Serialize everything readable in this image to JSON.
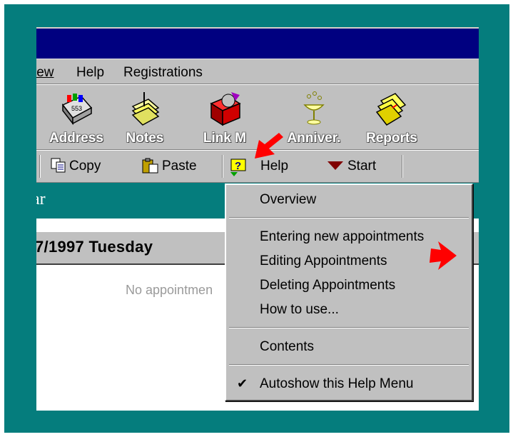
{
  "menubar": {
    "items": [
      {
        "label": "iew",
        "underline_index": 0
      },
      {
        "label": "Help",
        "underline_index": 0
      },
      {
        "label": "Registrations",
        "underline_index": 0
      }
    ]
  },
  "toolbar_large": {
    "buttons": [
      {
        "label": "Address",
        "icon": "address-book-icon"
      },
      {
        "label": "Notes",
        "icon": "notes-icon"
      },
      {
        "label": "Link M",
        "icon": "link-manager-icon"
      },
      {
        "label": "Anniver.",
        "icon": "anniversary-icon"
      },
      {
        "label": "Reports",
        "icon": "reports-icon"
      }
    ]
  },
  "toolbar_small": {
    "copy_label": "Copy",
    "paste_label": "Paste",
    "help_label": "Help",
    "start_label": "Start"
  },
  "section": {
    "title": "ar"
  },
  "date_header": {
    "text": "7/1997 Tuesday"
  },
  "content": {
    "empty_message": "No appointmen"
  },
  "help_menu": {
    "items": [
      {
        "label": "Overview"
      },
      {
        "label": "Entering new appointments"
      },
      {
        "label": "Editing Appointments"
      },
      {
        "label": "Deleting Appointments"
      },
      {
        "label": "How to use..."
      },
      {
        "label": "Contents"
      },
      {
        "label": "Autoshow this Help Menu",
        "checked": true
      }
    ]
  },
  "colors": {
    "desktop": "#057d7d",
    "titlebar": "#000080",
    "face": "#c0c0c0",
    "annotation_arrow": "#ff0000"
  }
}
